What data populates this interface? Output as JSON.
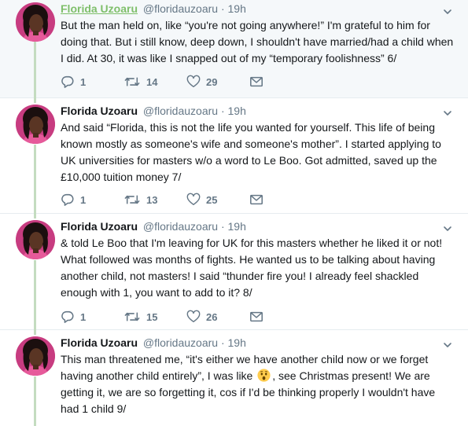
{
  "tweets": [
    {
      "name": "Florida Uzoaru",
      "handle": "@floridauzoaru",
      "separator": "·",
      "time": "19h",
      "text": "But the man held on, like “you're not going anywhere!” I'm grateful to him for doing that. But i still know, deep down, I shouldn't have married/had a child when I did. At 30, it was like I snapped out of my “temporary foolishness” 6/",
      "replies": "1",
      "retweets": "14",
      "likes": "29"
    },
    {
      "name": "Florida Uzoaru",
      "handle": "@floridauzoaru",
      "separator": "·",
      "time": "19h",
      "text": "And said “Florida, this is not the life you wanted for yourself. This life of being known mostly as someone's wife and someone's mother”. I started applying to UK universities for masters w/o a word to Le Boo. Got admitted, saved up the £10,000 tuition money 7/",
      "replies": "1",
      "retweets": "13",
      "likes": "25"
    },
    {
      "name": "Florida Uzoaru",
      "handle": "@floridauzoaru",
      "separator": "·",
      "time": "19h",
      "text": "& told Le Boo that I'm leaving for UK for this masters whether he liked it or not! What followed was months of fights. He wanted us to be talking about having another child, not masters! I said “thunder fire you! I already feel shackled enough with 1, you want to add to it? 8/",
      "replies": "1",
      "retweets": "15",
      "likes": "26"
    },
    {
      "name": "Florida Uzoaru",
      "handle": "@floridauzoaru",
      "separator": "·",
      "time": "19h",
      "text_before_emoji": "This man threatened me, “it's either we have another child now or we forget having another child entirely”, I was like ",
      "emoji": "astonished-face-emoji",
      "text_after_emoji": ", see Christmas present! We are getting it, we are so forgetting it, cos if I'd be thinking properly I wouldn't have had 1 child 9/"
    }
  ],
  "colors": {
    "thread_line": "#c4dcc0",
    "name_link": "#7fbf6b",
    "muted": "#657786",
    "highlight_bg": "#f5f8fa"
  },
  "icons": [
    "reply-icon",
    "retweet-icon",
    "like-icon",
    "direct-message-icon",
    "chevron-down-icon"
  ]
}
